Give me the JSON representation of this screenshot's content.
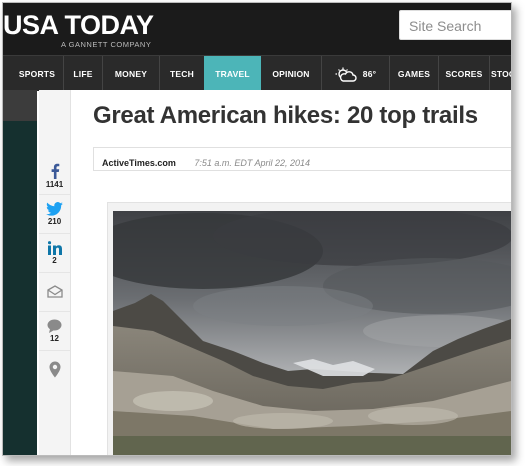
{
  "masthead": {
    "logo": "USA TODAY",
    "subtitle": "A GANNETT COMPANY",
    "search_placeholder": "Site Search"
  },
  "nav": {
    "items": [
      {
        "label": "SPORTS"
      },
      {
        "label": "LIFE"
      },
      {
        "label": "MONEY"
      },
      {
        "label": "TECH"
      },
      {
        "label": "TRAVEL",
        "active": true
      },
      {
        "label": "OPINION"
      },
      {
        "label": "86°",
        "icon": "weather-partly-cloudy-icon"
      },
      {
        "label": "GAMES"
      },
      {
        "label": "SCORES"
      },
      {
        "label": "STOC"
      }
    ],
    "active_color": "#4cb5b8"
  },
  "share": [
    {
      "icon": "facebook-icon",
      "count": "1141",
      "color": "#3b5998"
    },
    {
      "icon": "twitter-icon",
      "count": "210",
      "color": "#1da1f2"
    },
    {
      "icon": "linkedin-icon",
      "count": "2",
      "color": "#0e76a8"
    },
    {
      "icon": "email-icon",
      "count": "",
      "color": "#8a8a8a"
    },
    {
      "icon": "comment-icon",
      "count": "12",
      "color": "#8a8a8a"
    },
    {
      "icon": "location-pin-icon",
      "count": "",
      "color": "#8a8a8a"
    }
  ],
  "article": {
    "headline": "Great American hikes: 20 top trails",
    "source": "ActiveTimes.com",
    "timestamp": "7:51 a.m. EDT April 22, 2014"
  }
}
